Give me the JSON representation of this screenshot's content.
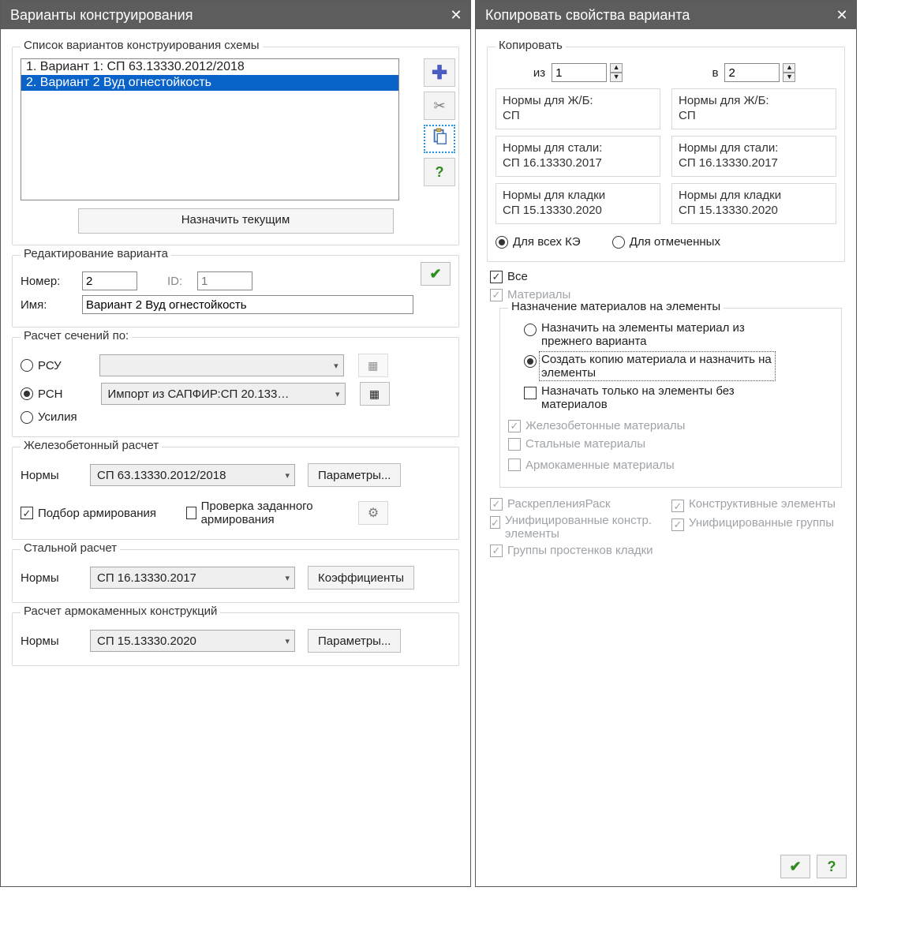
{
  "dialog1": {
    "title": "Варианты конструирования",
    "group_list": {
      "title": "Список вариантов конструирования схемы",
      "items": [
        "1. Вариант 1: СП 63.13330.2012/2018",
        "2. Вариант 2 Вуд огнестойкость"
      ],
      "selected_index": 1,
      "assign_current": "Назначить текущим"
    },
    "group_edit": {
      "title": "Редактирование варианта",
      "number_label": "Номер:",
      "number_value": "2",
      "id_label": "ID:",
      "id_value": "1",
      "name_label": "Имя:",
      "name_value": "Вариант 2 Вуд огнестойкость"
    },
    "group_calc": {
      "title": "Расчет сечений по:",
      "rsu": "РСУ",
      "rsn": "РСН",
      "forces": "Усилия",
      "rsn_combo": "Импорт из САПФИР:СП 20.133…"
    },
    "group_rc": {
      "title": "Железобетонный  расчет",
      "norms_label": "Нормы",
      "norms_combo": "СП 63.13330.2012/2018",
      "params_btn": "Параметры...",
      "pick_reinf": "Подбор армирования",
      "check_reinf": "Проверка заданного армирования"
    },
    "group_steel": {
      "title": "Стальной расчет",
      "norms_label": "Нормы",
      "norms_combo": "СП 16.13330.2017",
      "coef_btn": "Коэффициенты"
    },
    "group_masonry": {
      "title": "Расчет армокаменных конструкций",
      "norms_label": "Нормы",
      "norms_combo": "СП 15.13330.2020",
      "params_btn": "Параметры..."
    }
  },
  "dialog2": {
    "title": "Копировать свойства варианта",
    "group_copy": {
      "title": "Копировать",
      "from_label": "из",
      "from_value": "1",
      "to_label": "в",
      "to_value": "2",
      "norms_rc_title": "Нормы для Ж/Б:",
      "norms_rc_from": "СП",
      "norms_rc_to": "СП",
      "norms_steel_title": "Нормы для стали:",
      "norms_steel_from": "СП 16.13330.2017",
      "norms_steel_to": "СП 16.13330.2017",
      "norms_masonry_title": "Нормы для кладки",
      "norms_masonry_from": "СП 15.13330.2020",
      "norms_masonry_to": "СП 15.13330.2020",
      "radio_all_fe": "Для всех КЭ",
      "radio_marked": "Для отмеченных"
    },
    "all_check": "Все",
    "materials_check": "Материалы",
    "materials_group": {
      "title": "Назначение материалов на элементы",
      "rad_prev": "Назначить на элементы материал из прежнего варианта",
      "rad_copy": "Создать копию материала и назначить на элементы",
      "chk_only_empty": "Назначать только на элементы без материалов",
      "chk_rc_mat": "Железобетонные материалы",
      "chk_steel_mat": "Стальные материалы",
      "chk_masonry_mat": "Армокаменные материалы"
    },
    "bottom_checks": {
      "bracing": "РаскрепленияРаск",
      "constr_el": "Конструктивные элементы",
      "unified_constr": "Унифицированные констр. элементы",
      "unified_groups": "Унифицированные группы",
      "wall_groups": "Группы простенков кладки"
    }
  }
}
